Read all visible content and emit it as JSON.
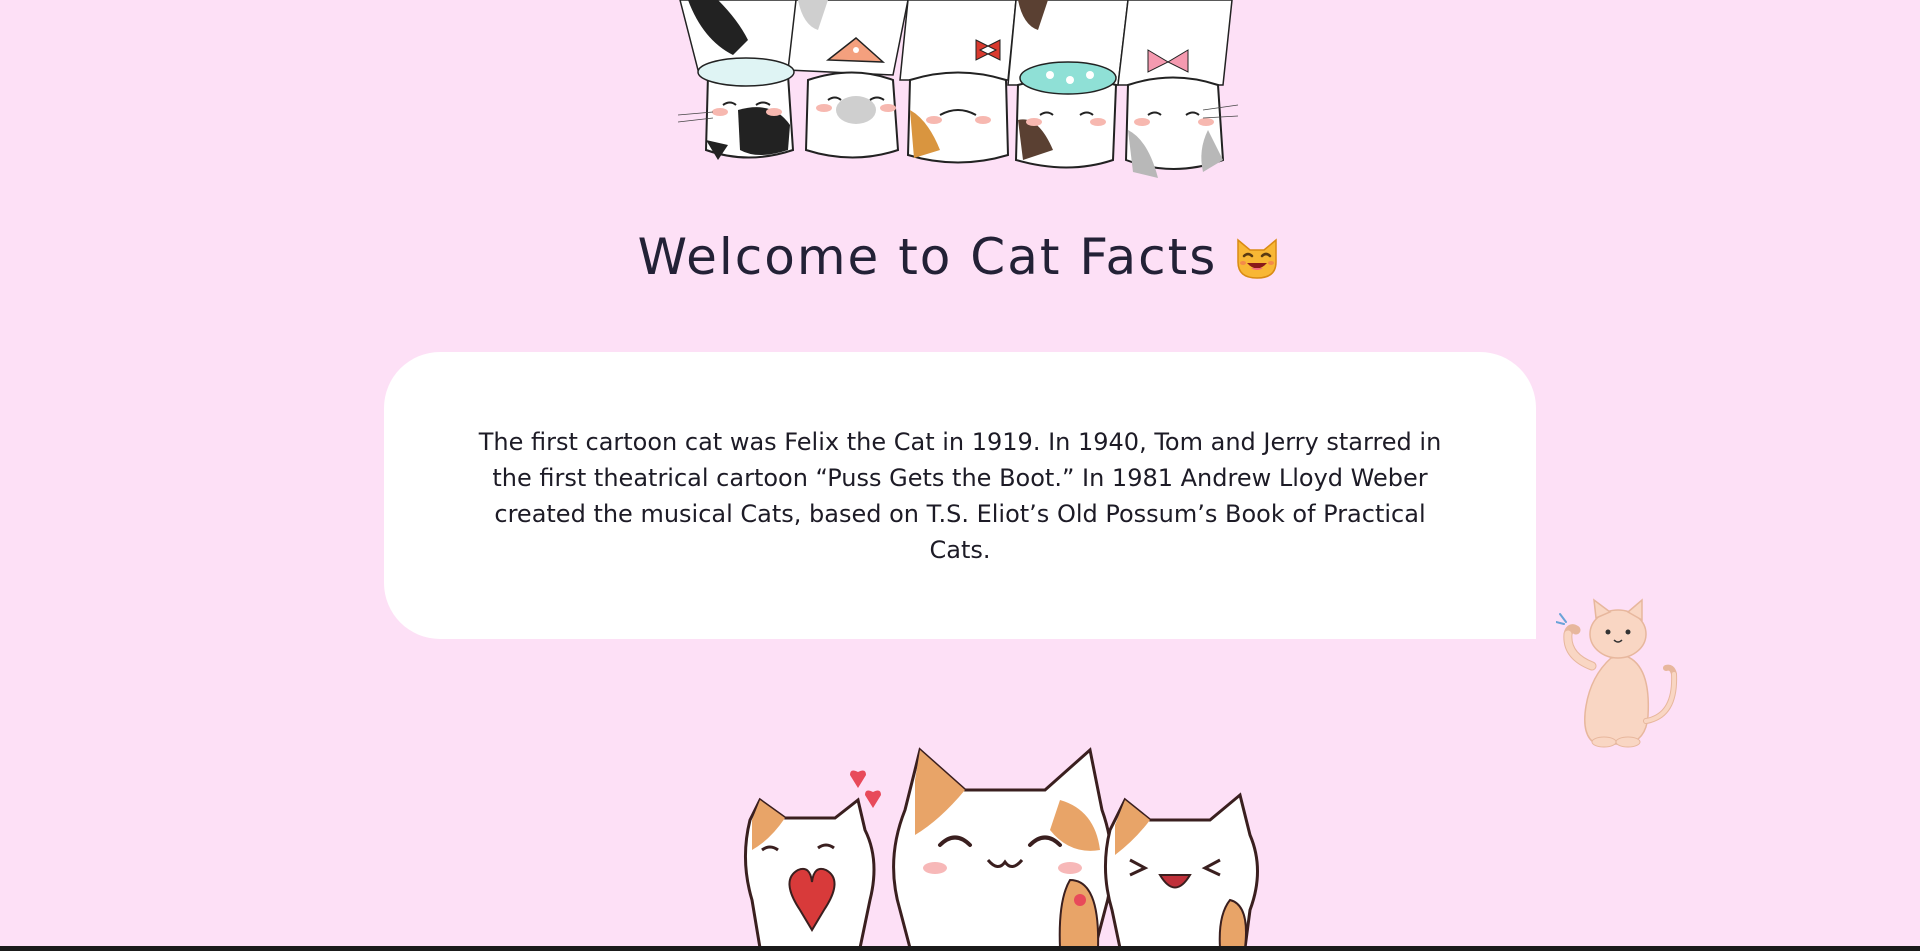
{
  "header": {
    "title": "Welcome to Cat Facts",
    "title_emoji": "smiling-cat-emoji"
  },
  "fact": {
    "text": "The first cartoon cat was Felix the Cat in 1919. In 1940, Tom and Jerry starred in the first theatrical cartoon “Puss Gets the Boot.” In 1981 Andrew Lloyd Weber created the musical Cats, based on T.S. Eliot’s Old Possum’s Book of Practical Cats."
  },
  "images": {
    "top": "hanging-cats-illustration",
    "side": "waving-cat-illustration",
    "bottom": "three-happy-cats-illustration"
  },
  "colors": {
    "background": "#fde0f6",
    "card": "#ffffff",
    "text": "#232136"
  }
}
